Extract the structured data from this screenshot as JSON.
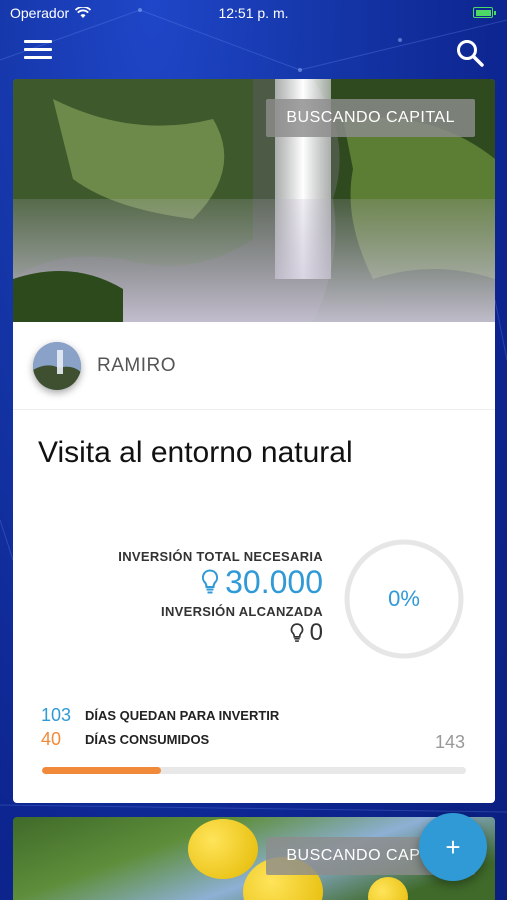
{
  "status_bar": {
    "carrier": "Operador",
    "time": "12:51 p. m."
  },
  "icons": {
    "menu": "hamburger-icon",
    "search": "search-icon",
    "investment": "lightbulb-icon",
    "add": "plus-icon"
  },
  "colors": {
    "accent": "#2f9ad6",
    "orange": "#f08a3a",
    "background": "#1536a8"
  },
  "project": {
    "status": "BUSCANDO CAPITAL",
    "owner": "RAMIRO",
    "title": "Visita al entorno natural",
    "investment_total_label": "INVERSIÓN TOTAL NECESARIA",
    "investment_total": "30.000",
    "investment_reached_label": "INVERSIÓN ALCANZADA",
    "investment_reached": "0",
    "progress_percent_text": "0%",
    "progress_fraction": 0,
    "days_left": "103",
    "days_left_label": "DÍAS QUEDAN PARA INVERTIR",
    "days_consumed": "40",
    "days_consumed_label": "DÍAS CONSUMIDOS",
    "days_total": "143",
    "days_consumed_fraction": 0.28
  },
  "project2": {
    "status": "BUSCANDO CAPITAL"
  },
  "fab": {
    "label": "+"
  }
}
